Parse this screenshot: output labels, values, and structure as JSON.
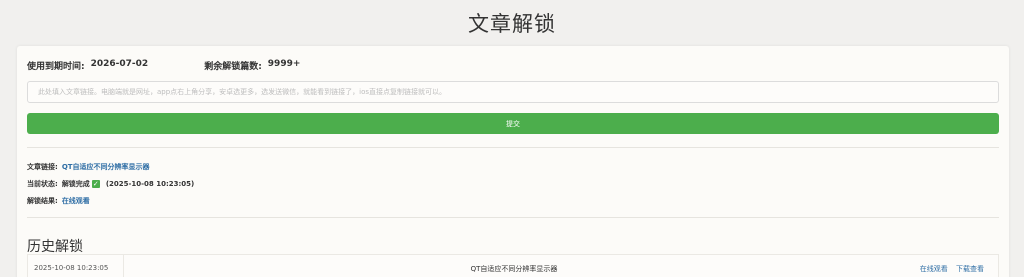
{
  "page": {
    "title": "文章解锁"
  },
  "info": {
    "expire_label": "使用到期时间:",
    "expire_value": "2026-07-02",
    "remaining_label": "剩余解锁篇数:",
    "remaining_value": "9999+"
  },
  "input": {
    "placeholder": "此处填入文章链接。电脑端就是网址，app点右上角分享，安卓选更多，选发送微信，就能看到链接了，ios直接点复制链接就可以。",
    "value": ""
  },
  "submit_label": "提交",
  "result": {
    "link_label": "文章链接:",
    "link_text": "QT自适应不同分辨率显示器",
    "status_label": "当前状态:",
    "status_text": "解锁完成",
    "status_icon": "check-icon",
    "status_time": "(2025-10-08 10:23:05)",
    "result_label": "解锁结果:",
    "result_link": "在线观看"
  },
  "history": {
    "title": "历史解锁",
    "rows": [
      {
        "time": "2025-10-08 10:23:05",
        "title": "QT自适应不同分辨率显示器",
        "view_label": "在线观看",
        "download_label": "下载查看"
      }
    ]
  },
  "colors": {
    "accent": "#4cae4c",
    "link": "#2f6ea5"
  }
}
